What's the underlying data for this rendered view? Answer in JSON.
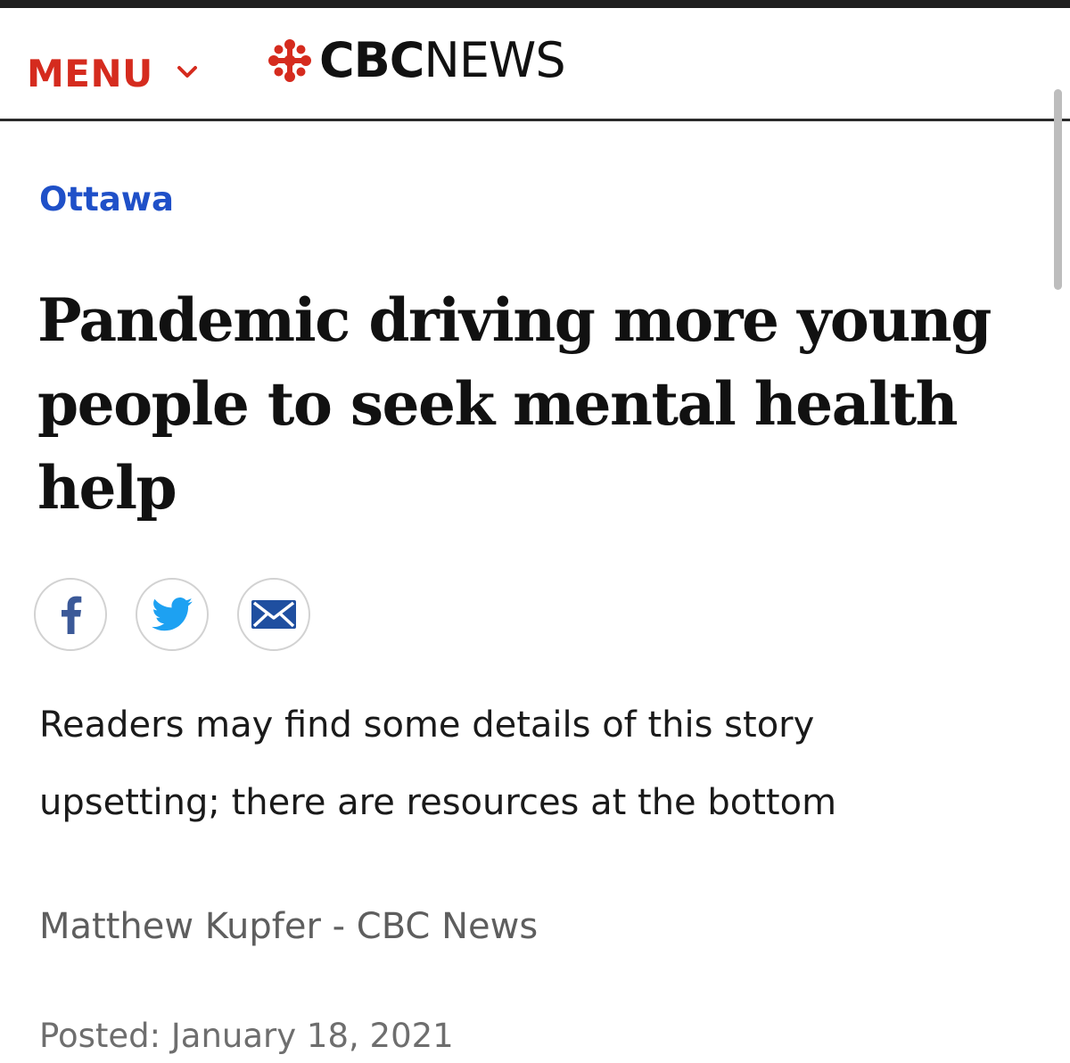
{
  "colors": {
    "brand_red": "#d52b1e",
    "section_blue": "#1f50c8",
    "facebook_blue": "#3b5998",
    "twitter_blue": "#1da1f2",
    "email_blue": "#1f4fa0",
    "text_dark": "#111111",
    "text_muted": "#5e5e5e"
  },
  "header": {
    "menu_label": "MENU",
    "menu_icon": "chevron-down-icon",
    "logo": {
      "icon": "cbc-gem-icon",
      "bold": "CBC",
      "light": "NEWS"
    }
  },
  "article": {
    "section": "Ottawa",
    "headline": "Pandemic driving more young people to seek mental health help",
    "share": [
      {
        "icon": "facebook-icon"
      },
      {
        "icon": "twitter-icon"
      },
      {
        "icon": "email-icon"
      }
    ],
    "warning": "Readers may find some details of this story upsetting; there are resources at the bottom",
    "byline": "Matthew Kupfer - CBC News",
    "posted": "Posted: January 18, 2021"
  }
}
